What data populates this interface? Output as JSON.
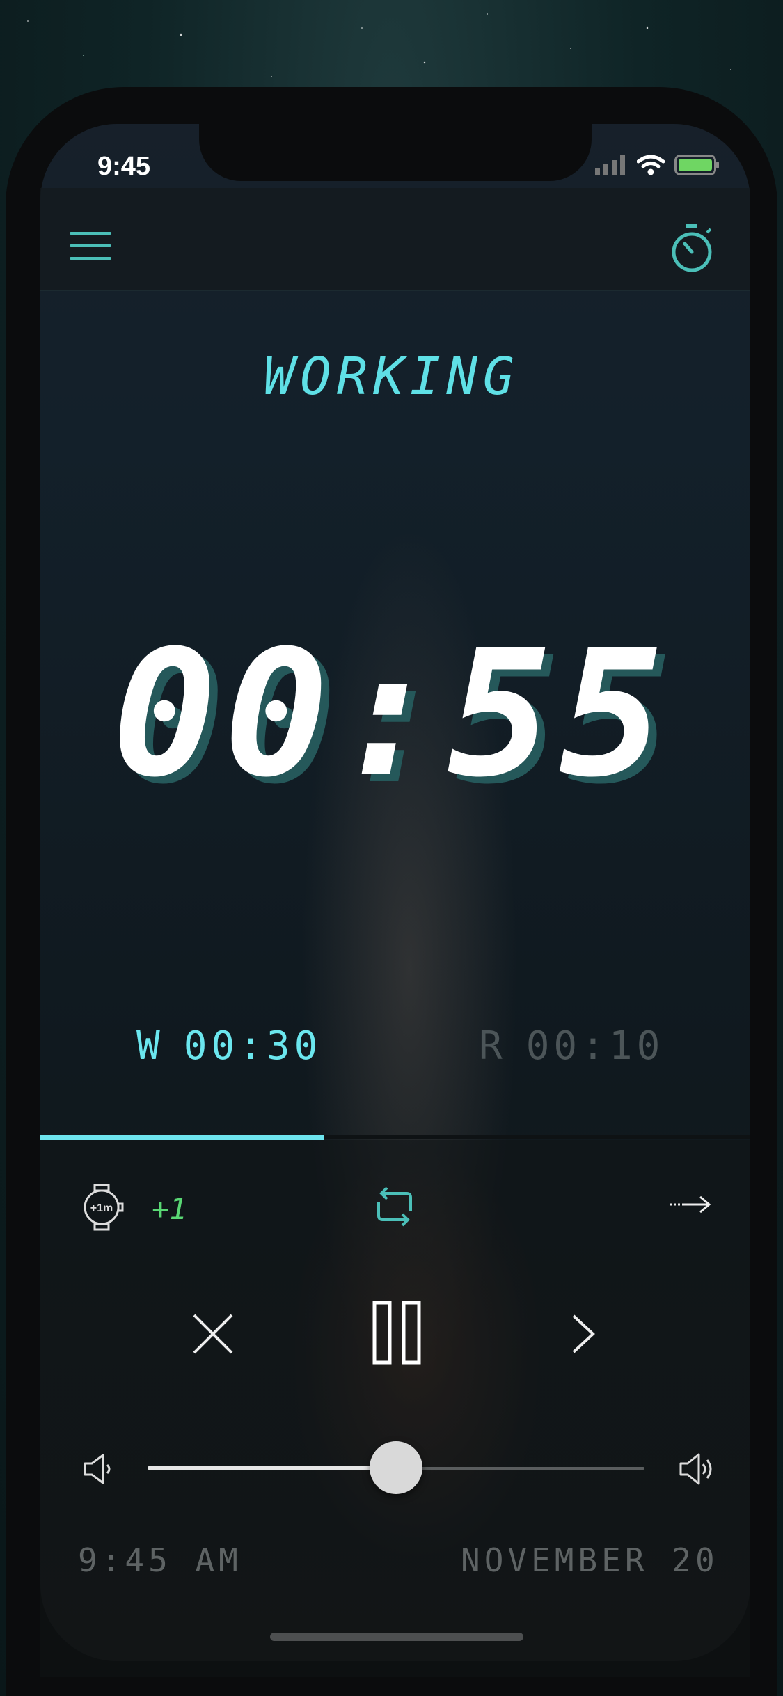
{
  "status_bar": {
    "time": "9:45"
  },
  "header": {
    "menu_icon": "hamburger-menu-icon",
    "timer_icon": "stopwatch-icon"
  },
  "timer": {
    "mode": "WORKING",
    "display": "00:55",
    "work_label": "W",
    "work_time": "00:30",
    "rest_label": "R",
    "rest_time": "00:10",
    "progress_fraction": 0.4
  },
  "controls": {
    "add_minute_icon": "watch-plus-1m-icon",
    "add_minute_icon_text": "+1m",
    "plus_count": "+1",
    "repeat_icon": "repeat-icon",
    "skip_icon": "dotted-arrow-right-icon",
    "cancel_icon": "close-icon",
    "pause_icon": "pause-icon",
    "next_icon": "chevron-right-icon"
  },
  "volume": {
    "level": 0.5,
    "low_icon": "speaker-low-icon",
    "high_icon": "speaker-high-icon"
  },
  "footer": {
    "clock": "9:45 AM",
    "date": "NOVEMBER 20"
  },
  "colors": {
    "accent": "#6de4ee",
    "plus_green": "#59d774",
    "teal_icon": "#4bbfb8",
    "muted": "#5e6364"
  }
}
